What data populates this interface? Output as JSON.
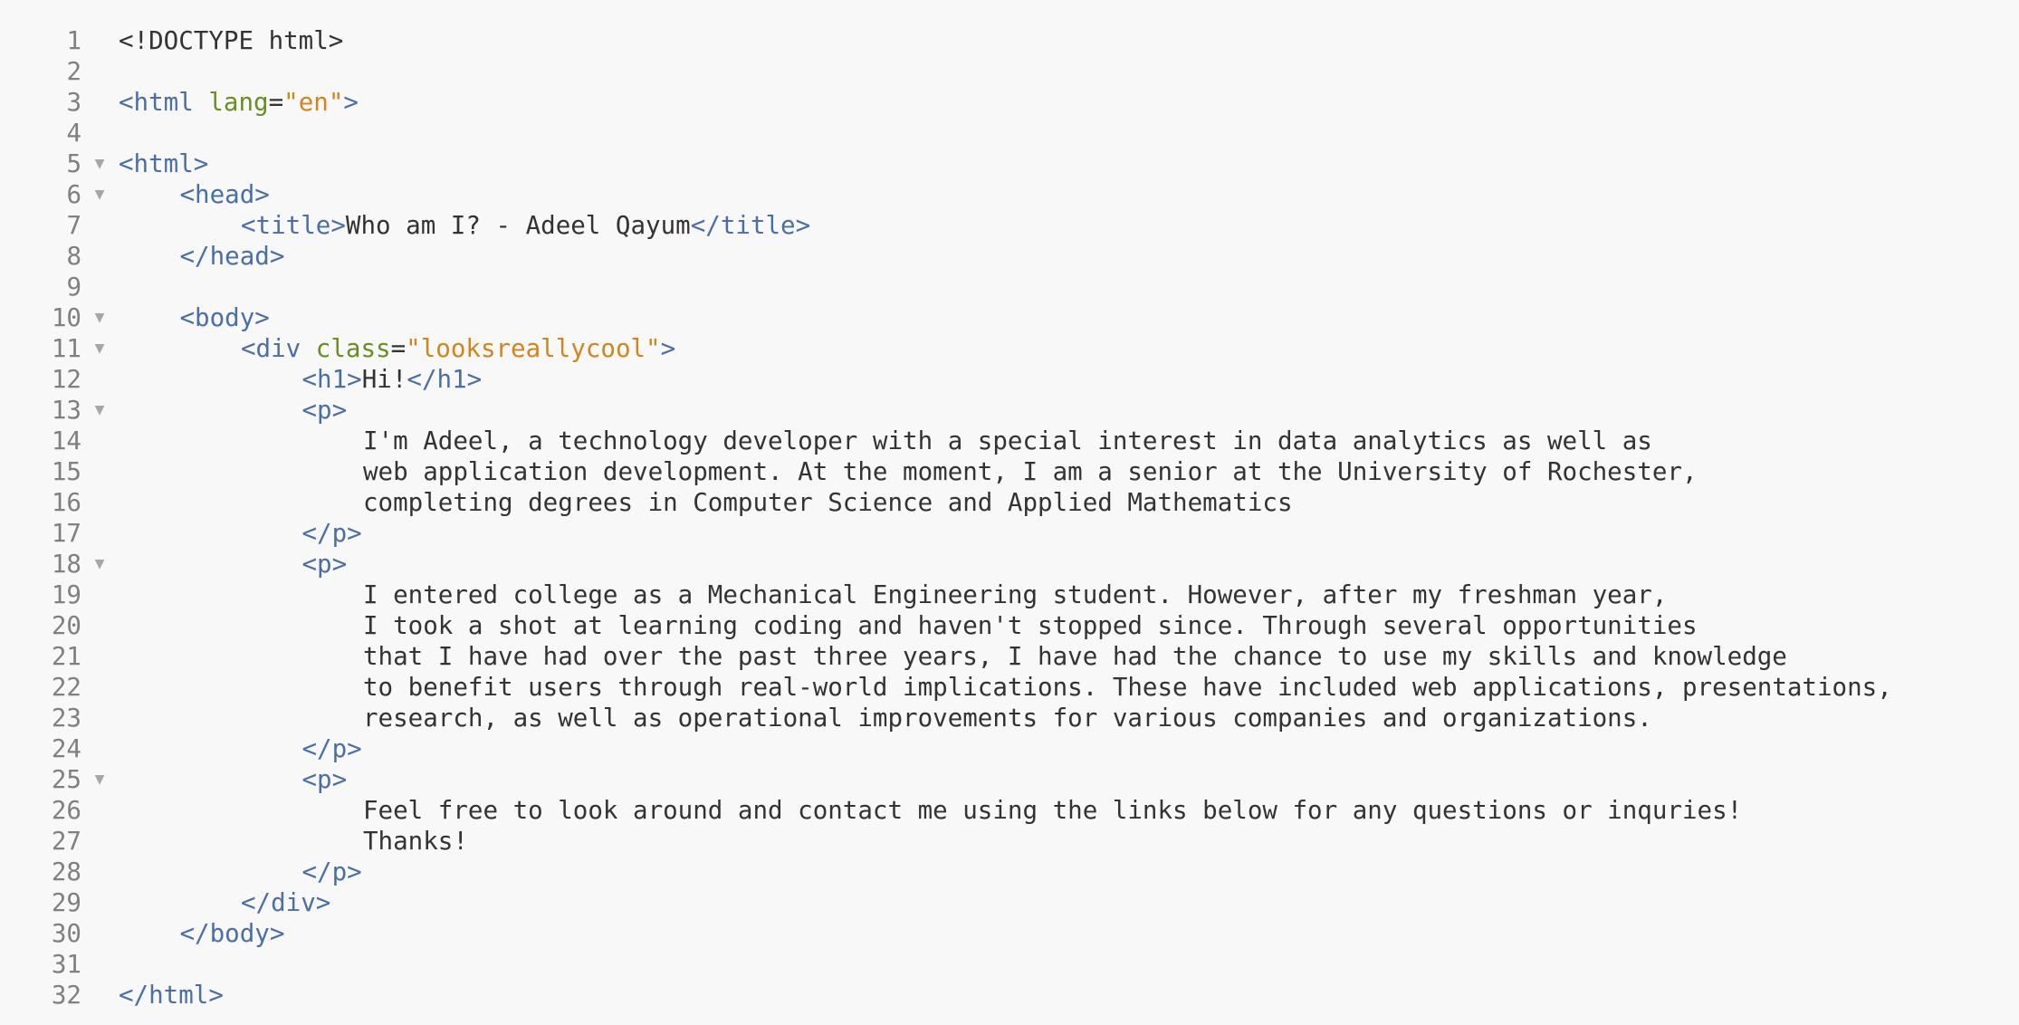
{
  "editor": {
    "fold_glyph": "▼",
    "lines": [
      {
        "n": "1",
        "fold": false,
        "indent": 0,
        "tokens": [
          {
            "t": "txt",
            "v": "<!DOCTYPE html>"
          }
        ]
      },
      {
        "n": "2",
        "fold": false,
        "indent": 0,
        "tokens": []
      },
      {
        "n": "3",
        "fold": false,
        "indent": 0,
        "tokens": [
          {
            "t": "tag",
            "v": "<html"
          },
          {
            "t": "txt",
            "v": " "
          },
          {
            "t": "attr",
            "v": "lang"
          },
          {
            "t": "txt",
            "v": "="
          },
          {
            "t": "val",
            "v": "\"en\""
          },
          {
            "t": "tag",
            "v": ">"
          }
        ]
      },
      {
        "n": "4",
        "fold": false,
        "indent": 0,
        "tokens": []
      },
      {
        "n": "5",
        "fold": true,
        "indent": 0,
        "tokens": [
          {
            "t": "tag",
            "v": "<html>"
          }
        ]
      },
      {
        "n": "6",
        "fold": true,
        "indent": 1,
        "tokens": [
          {
            "t": "tag",
            "v": "<head>"
          }
        ]
      },
      {
        "n": "7",
        "fold": false,
        "indent": 2,
        "tokens": [
          {
            "t": "tag",
            "v": "<title>"
          },
          {
            "t": "txt",
            "v": "Who am I? - Adeel Qayum"
          },
          {
            "t": "tag",
            "v": "</title>"
          }
        ]
      },
      {
        "n": "8",
        "fold": false,
        "indent": 1,
        "tokens": [
          {
            "t": "tag",
            "v": "</head>"
          }
        ]
      },
      {
        "n": "9",
        "fold": false,
        "indent": 0,
        "tokens": []
      },
      {
        "n": "10",
        "fold": true,
        "indent": 1,
        "tokens": [
          {
            "t": "tag",
            "v": "<body>"
          }
        ]
      },
      {
        "n": "11",
        "fold": true,
        "indent": 2,
        "tokens": [
          {
            "t": "tag",
            "v": "<div"
          },
          {
            "t": "txt",
            "v": " "
          },
          {
            "t": "attr",
            "v": "class"
          },
          {
            "t": "txt",
            "v": "="
          },
          {
            "t": "val",
            "v": "\"looksreallycool\""
          },
          {
            "t": "tag",
            "v": ">"
          }
        ]
      },
      {
        "n": "12",
        "fold": false,
        "indent": 3,
        "tokens": [
          {
            "t": "tag",
            "v": "<h1>"
          },
          {
            "t": "txt",
            "v": "Hi!"
          },
          {
            "t": "tag",
            "v": "</h1>"
          }
        ]
      },
      {
        "n": "13",
        "fold": true,
        "indent": 3,
        "tokens": [
          {
            "t": "tag",
            "v": "<p>"
          }
        ]
      },
      {
        "n": "14",
        "fold": false,
        "indent": 4,
        "tokens": [
          {
            "t": "txt",
            "v": "I'm Adeel, a technology developer with a special interest in data analytics as well as"
          }
        ]
      },
      {
        "n": "15",
        "fold": false,
        "indent": 4,
        "tokens": [
          {
            "t": "txt",
            "v": "web application development. At the moment, I am a senior at the University of Rochester,"
          }
        ]
      },
      {
        "n": "16",
        "fold": false,
        "indent": 4,
        "tokens": [
          {
            "t": "txt",
            "v": "completing degrees in Computer Science and Applied Mathematics"
          }
        ]
      },
      {
        "n": "17",
        "fold": false,
        "indent": 3,
        "tokens": [
          {
            "t": "tag",
            "v": "</p>"
          }
        ]
      },
      {
        "n": "18",
        "fold": true,
        "indent": 3,
        "tokens": [
          {
            "t": "tag",
            "v": "<p>"
          }
        ]
      },
      {
        "n": "19",
        "fold": false,
        "indent": 4,
        "tokens": [
          {
            "t": "txt",
            "v": "I entered college as a Mechanical Engineering student. However, after my freshman year,"
          }
        ]
      },
      {
        "n": "20",
        "fold": false,
        "indent": 4,
        "tokens": [
          {
            "t": "txt",
            "v": "I took a shot at learning coding and haven't stopped since. Through several opportunities"
          }
        ]
      },
      {
        "n": "21",
        "fold": false,
        "indent": 4,
        "tokens": [
          {
            "t": "txt",
            "v": "that I have had over the past three years, I have had the chance to use my skills and knowledge"
          }
        ]
      },
      {
        "n": "22",
        "fold": false,
        "indent": 4,
        "tokens": [
          {
            "t": "txt",
            "v": "to benefit users through real-world implications. These have included web applications, presentations,"
          }
        ]
      },
      {
        "n": "23",
        "fold": false,
        "indent": 4,
        "tokens": [
          {
            "t": "txt",
            "v": "research, as well as operational improvements for various companies and organizations."
          }
        ]
      },
      {
        "n": "24",
        "fold": false,
        "indent": 3,
        "tokens": [
          {
            "t": "tag",
            "v": "</p>"
          }
        ]
      },
      {
        "n": "25",
        "fold": true,
        "indent": 3,
        "tokens": [
          {
            "t": "tag",
            "v": "<p>"
          }
        ]
      },
      {
        "n": "26",
        "fold": false,
        "indent": 4,
        "tokens": [
          {
            "t": "txt",
            "v": "Feel free to look around and contact me using the links below for any questions or inquries!"
          }
        ]
      },
      {
        "n": "27",
        "fold": false,
        "indent": 4,
        "tokens": [
          {
            "t": "txt",
            "v": "Thanks!"
          }
        ]
      },
      {
        "n": "28",
        "fold": false,
        "indent": 3,
        "tokens": [
          {
            "t": "tag",
            "v": "</p>"
          }
        ]
      },
      {
        "n": "29",
        "fold": false,
        "indent": 2,
        "tokens": [
          {
            "t": "tag",
            "v": "</div>"
          }
        ]
      },
      {
        "n": "30",
        "fold": false,
        "indent": 1,
        "tokens": [
          {
            "t": "tag",
            "v": "</body>"
          }
        ]
      },
      {
        "n": "31",
        "fold": false,
        "indent": 0,
        "tokens": []
      },
      {
        "n": "32",
        "fold": false,
        "indent": 0,
        "tokens": [
          {
            "t": "tag",
            "v": "</html>"
          }
        ]
      }
    ]
  }
}
